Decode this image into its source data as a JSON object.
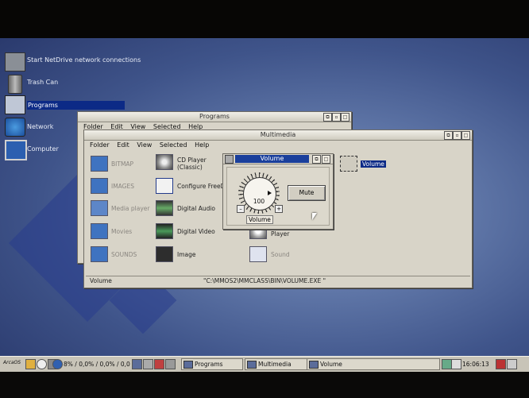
{
  "desktop": {
    "icons": [
      {
        "label": "Start NetDrive network connections",
        "icon": "netdrive-icon"
      },
      {
        "label": "Trash Can",
        "icon": "trash-can-icon"
      },
      {
        "label": "Programs",
        "icon": "programs-folder-icon"
      },
      {
        "label": "Network",
        "icon": "network-globe-icon"
      },
      {
        "label": "Computer",
        "icon": "computer-monitor-icon"
      }
    ]
  },
  "programs_window": {
    "title": "Programs",
    "menu": [
      "Folder",
      "Edit",
      "View",
      "Selected",
      "Help"
    ]
  },
  "multimedia_window": {
    "title": "Multimedia",
    "menu": [
      "Folder",
      "Edit",
      "View",
      "Selected",
      "Help"
    ],
    "items": [
      {
        "label": "BITMAP",
        "dim": true
      },
      {
        "label": "IMAGES",
        "dim": true
      },
      {
        "label": "Media player",
        "dim": true
      },
      {
        "label": "Movies",
        "dim": true
      },
      {
        "label": "SOUNDS",
        "dim": true
      },
      {
        "label": "CD Player (Classic)",
        "dim": false
      },
      {
        "label": "Configure FreeDB",
        "dim": false
      },
      {
        "label": "Digital Audio",
        "dim": false
      },
      {
        "label": "Digital Video",
        "dim": false
      },
      {
        "label": "Image",
        "dim": false
      },
      {
        "label": "Software VideoCD Player",
        "dim": false
      },
      {
        "label": "Sound",
        "dim": true
      },
      {
        "label": "Volume",
        "selected": true
      }
    ],
    "status_left": "Volume",
    "status_path": "\"C:\\MMOS2\\MMCLASS\\BIN\\VOLUME.EXE \""
  },
  "volume_window": {
    "title": "Volume",
    "dial_value": "100",
    "dial_caption": "Volume",
    "mute_label": "Mute",
    "minus": "–",
    "plus": "+"
  },
  "taskbar": {
    "cpu_readout": "8% / 0,0% / 0,0% / 0,0",
    "tasks": [
      "Programs",
      "Multimedia",
      "Volume"
    ],
    "clock": "16:06:13",
    "os_label": "ArcaOS"
  },
  "colors": {
    "title_active": "#1a3f9c",
    "window_face": "#d8d4c8",
    "desktop": "#4a5f94"
  }
}
